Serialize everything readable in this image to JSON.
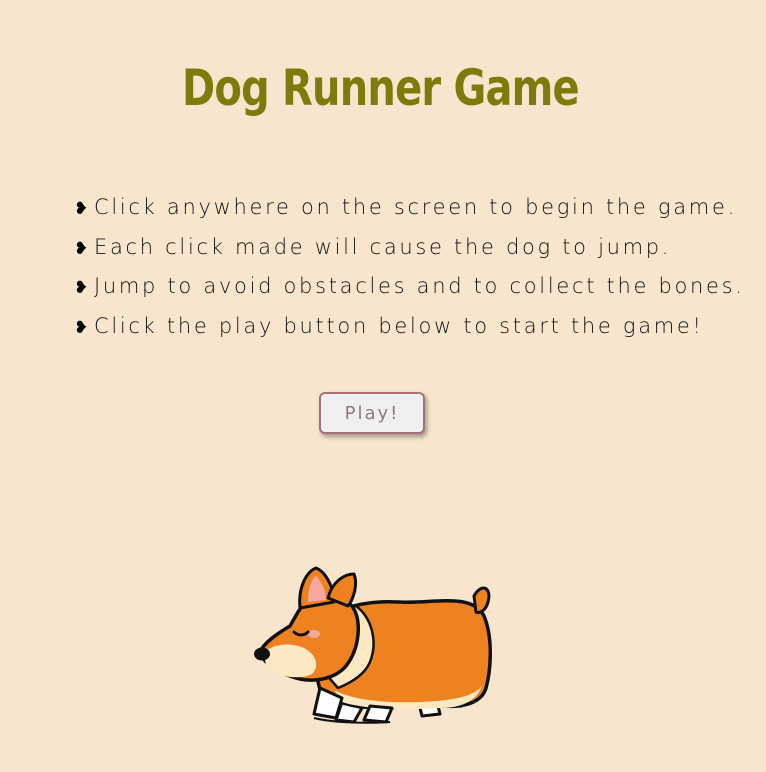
{
  "header": {
    "title": "Dog Runner Game"
  },
  "instructions": [
    {
      "bullet": "❥",
      "text": "Click anywhere on the screen to begin the game."
    },
    {
      "bullet": "❥",
      "text": "Each click made will cause the dog to jump."
    },
    {
      "bullet": "❥",
      "text": "Jump to avoid obstacles and to collect the bones."
    },
    {
      "bullet": "❥",
      "text": "Click the play button below to start the game!"
    }
  ],
  "controls": {
    "play_label": "Play!"
  },
  "colors": {
    "background": "#f7e6cd",
    "title": "#7e7b0c",
    "dog_orange": "#ee8220",
    "dog_cream": "#fde8c4"
  },
  "icons": {
    "bullet": "heart-bullet-icon",
    "character": "corgi-dog-sprite"
  }
}
